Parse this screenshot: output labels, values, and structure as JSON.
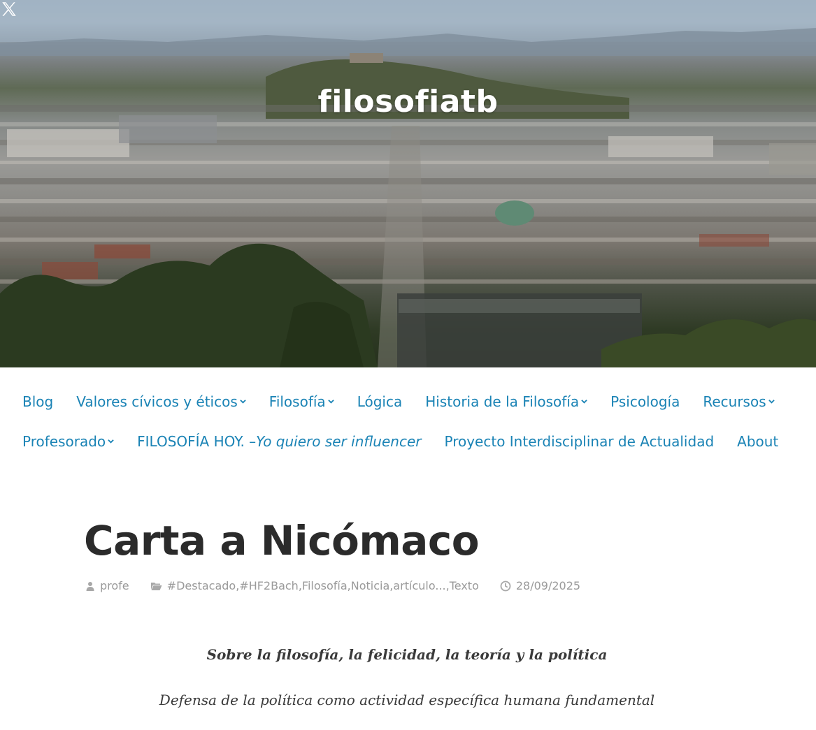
{
  "site": {
    "title": "filosofiatb",
    "social_icon": "x-icon"
  },
  "nav": {
    "row1": [
      {
        "label": "Blog",
        "has_submenu": false
      },
      {
        "label": "Valores cívicos y éticos",
        "has_submenu": true
      },
      {
        "label": "Filosofía",
        "has_submenu": true
      },
      {
        "label": "Lógica",
        "has_submenu": false
      },
      {
        "label": "Historia de la Filosofía",
        "has_submenu": true
      },
      {
        "label": "Psicología",
        "has_submenu": false
      },
      {
        "label": "Recursos",
        "has_submenu": true
      }
    ],
    "row2": [
      {
        "label": "Profesorado",
        "has_submenu": true
      },
      {
        "label_prefix": "FILOSOFÍA HOY. –",
        "label_italic": "Yo quiero ser influencer",
        "has_submenu": false
      },
      {
        "label": "Proyecto Interdisciplinar de Actualidad",
        "has_submenu": false
      },
      {
        "label": "About",
        "has_submenu": false
      }
    ]
  },
  "post": {
    "title": "Carta a Nicómaco",
    "author": "profe",
    "categories": [
      "#Destacado",
      "#HF2Bach",
      "Filosofía",
      "Noticia",
      "artículo...",
      "Texto"
    ],
    "date": "28/09/2025",
    "subtitle": "Sobre la filosofía, la felicidad, la teoría y la política",
    "lede": "Defensa de la política como actividad específica humana fundamental"
  },
  "colors": {
    "link": "#1a83b5",
    "title": "#2b2b2b",
    "meta": "#9a9a9a"
  }
}
